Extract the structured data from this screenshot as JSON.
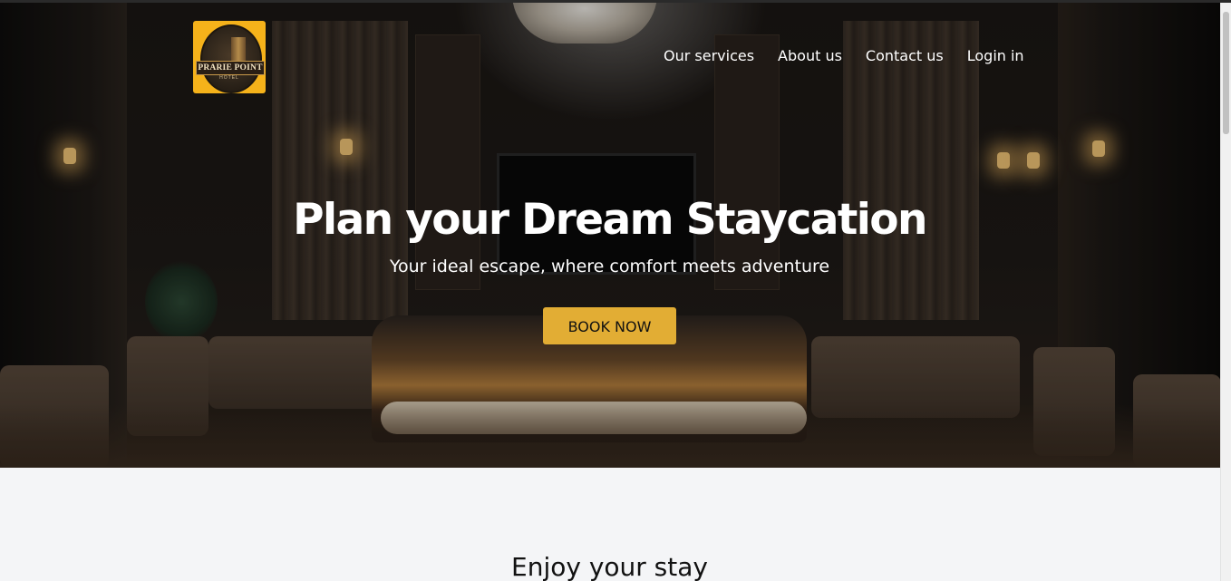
{
  "logo": {
    "name": "PRARIE POINT",
    "subtitle": "HOTEL"
  },
  "nav": {
    "items": [
      {
        "label": "Our services"
      },
      {
        "label": "About us"
      },
      {
        "label": "Contact us"
      },
      {
        "label": "Login in"
      }
    ]
  },
  "hero": {
    "title": "Plan your Dream Staycation",
    "subtitle": "Your ideal escape, where comfort meets adventure",
    "cta_label": "BOOK NOW"
  },
  "section": {
    "title": "Enjoy your stay"
  },
  "colors": {
    "accent": "#e2ad34",
    "logo_bg": "#f5b21a",
    "page_bg": "#f4f5f7"
  }
}
